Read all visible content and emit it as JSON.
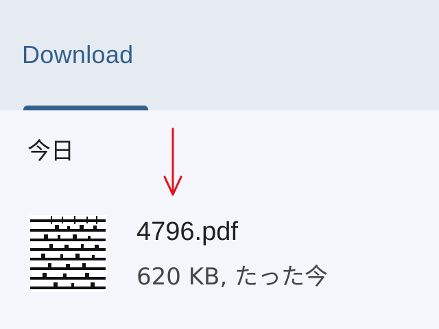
{
  "header": {
    "title": "Download"
  },
  "section": {
    "label": "今日"
  },
  "file": {
    "name": "4796.pdf",
    "meta": "620 KB, たった今"
  },
  "colors": {
    "accent": "#33608c",
    "header_bg": "#e6ebf2",
    "content_bg": "#f4f6fb",
    "annotation_arrow": "#e0141e"
  },
  "icons": {
    "thumbnail": "pdf-sheet-music-thumbnail",
    "arrow": "down-arrow-icon"
  }
}
